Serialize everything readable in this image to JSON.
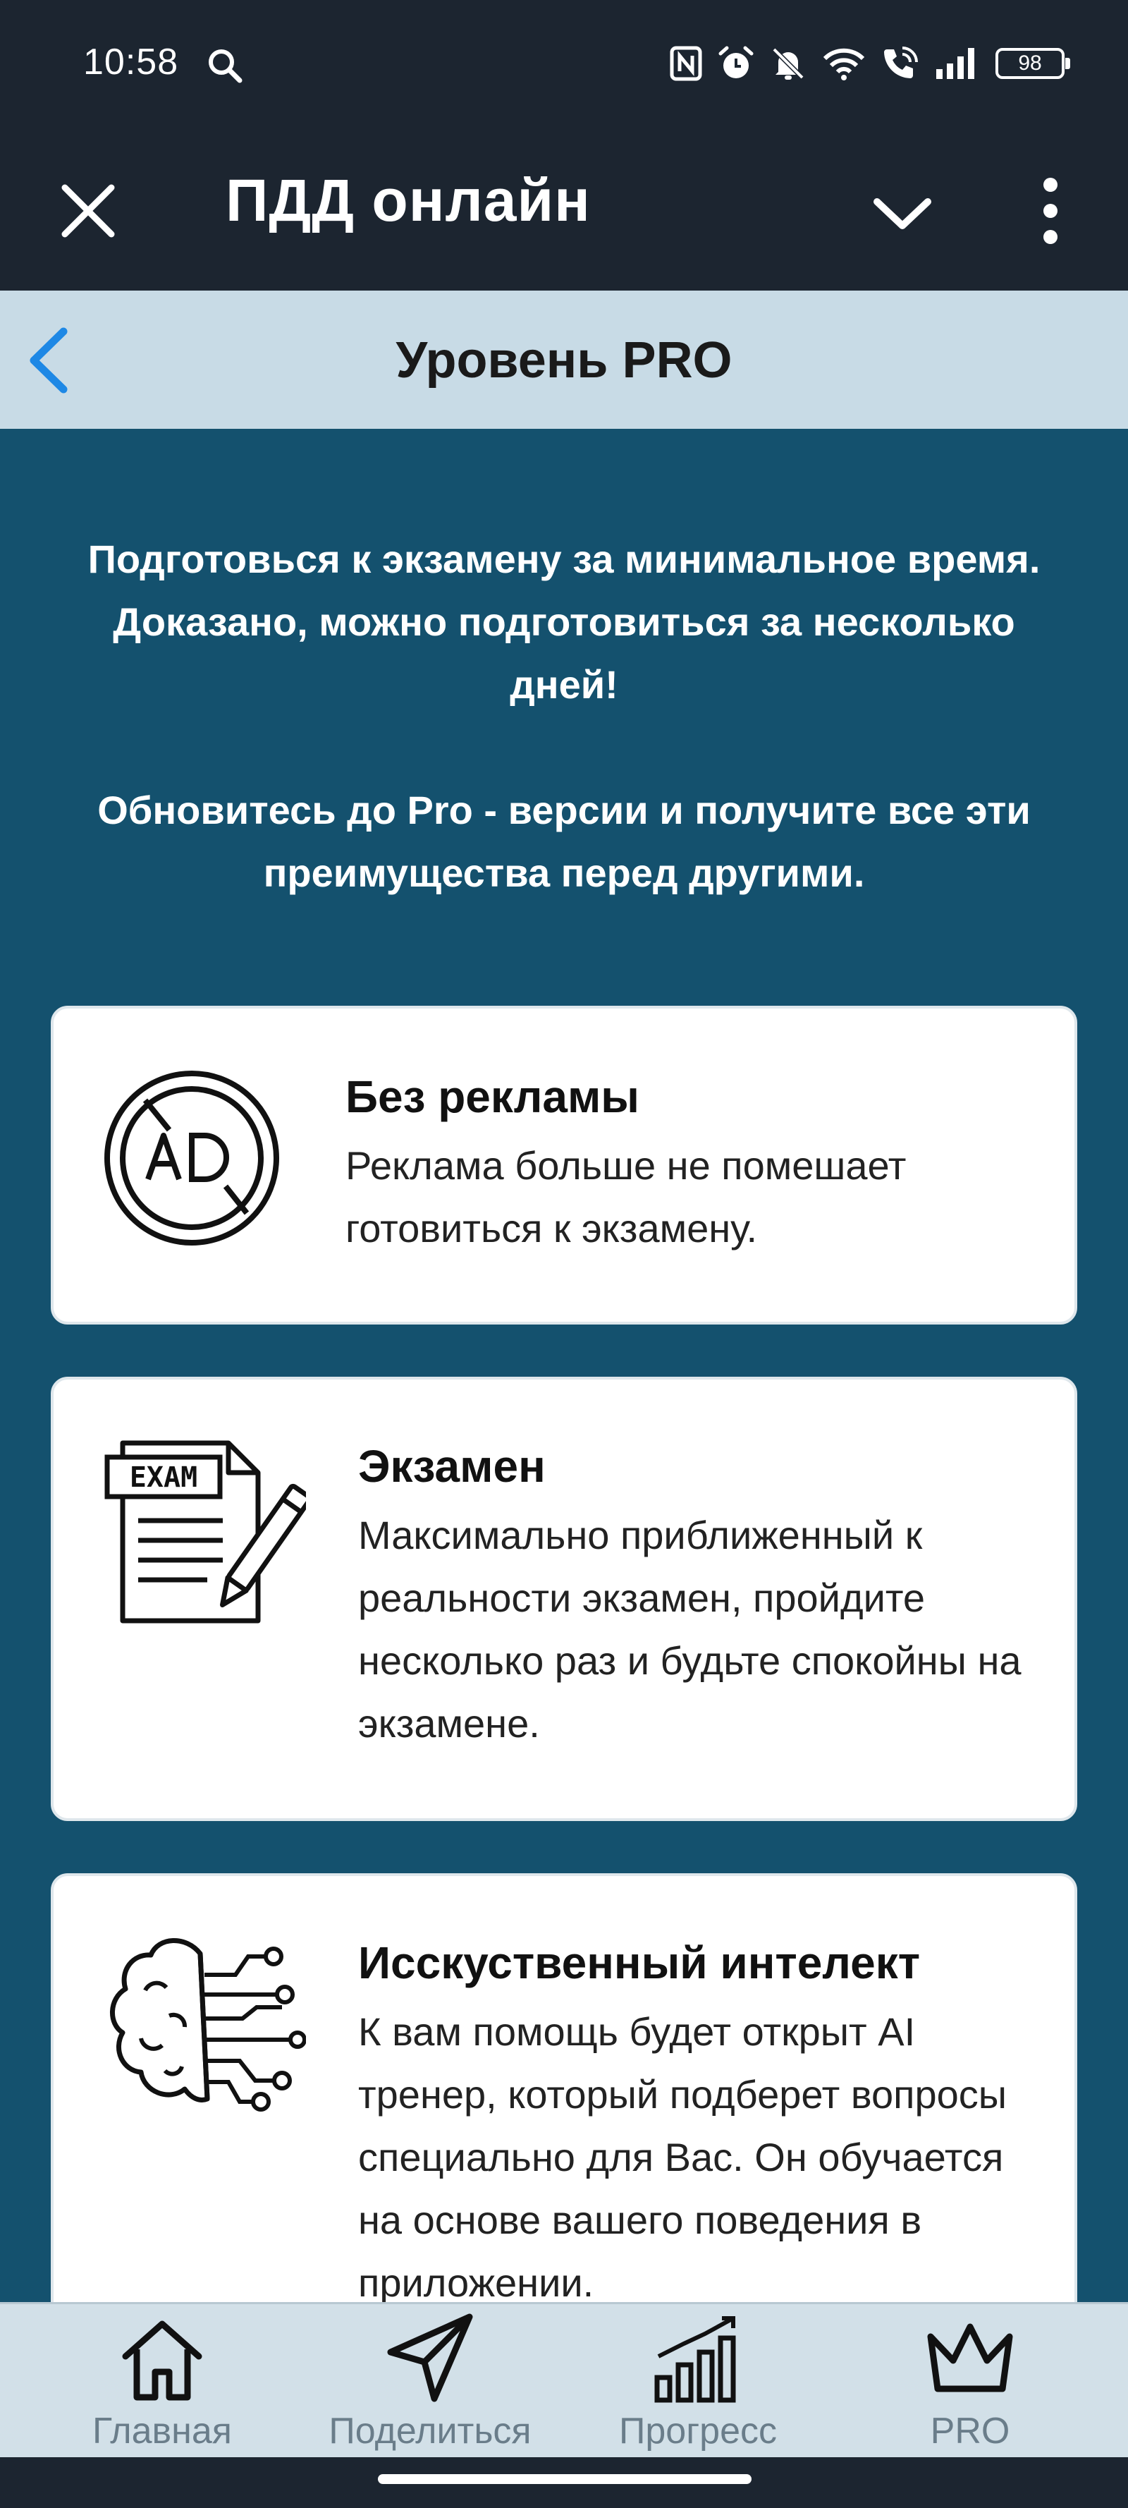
{
  "status_bar": {
    "time": "10:58",
    "battery": "98",
    "icons": [
      "search-icon",
      "nfc-icon",
      "alarm-icon",
      "muted-bell-icon",
      "wifi-icon",
      "wifi-calling-icon",
      "signal-icon",
      "battery-icon"
    ]
  },
  "app_bar": {
    "title": "ПДД онлайн",
    "icons": [
      "close-icon",
      "chevron-down-icon",
      "more-vertical-icon"
    ]
  },
  "sub_header": {
    "title": "Уровень PRO",
    "back_icon": "chevron-left-icon",
    "back_color": "#1e88e5"
  },
  "intro": {
    "paragraph_1": "Подготовься к экзамену за минимальное время. Доказано, можно подготовиться за несколько дней!",
    "paragraph_2": "Обновитесь до Pro - версии и получите все эти преимущества перед другими."
  },
  "features": [
    {
      "icon": "no-ads-icon",
      "title": "Без рекламы",
      "description": "Реклама больше не помешает готовиться к экзамену."
    },
    {
      "icon": "exam-icon",
      "title": "Экзамен",
      "description": "Максимально приближенный к реальности экзамен, пройдите несколько раз и будьте спокойны на экзамене."
    },
    {
      "icon": "ai-brain-icon",
      "title": "Исскуственный интелект",
      "description": "К вам помощь будет открыт AI тренер, который подберет вопросы специально для Вас. Он обучается на основе вашего поведения в приложении."
    }
  ],
  "bottom_nav": {
    "items": [
      {
        "label": "Главная",
        "icon": "home-icon"
      },
      {
        "label": "Поделиться",
        "icon": "send-icon"
      },
      {
        "label": "Прогресс",
        "icon": "progress-chart-icon"
      },
      {
        "label": "PRO",
        "icon": "crown-icon"
      }
    ]
  },
  "colors": {
    "top_bar": "#1c2530",
    "sub_header": "#c8dbe6",
    "content_background": "#14516e",
    "card_background": "#ffffff",
    "bottom_nav": "#d2e0e8",
    "nav_label": "#6a7d8a"
  }
}
